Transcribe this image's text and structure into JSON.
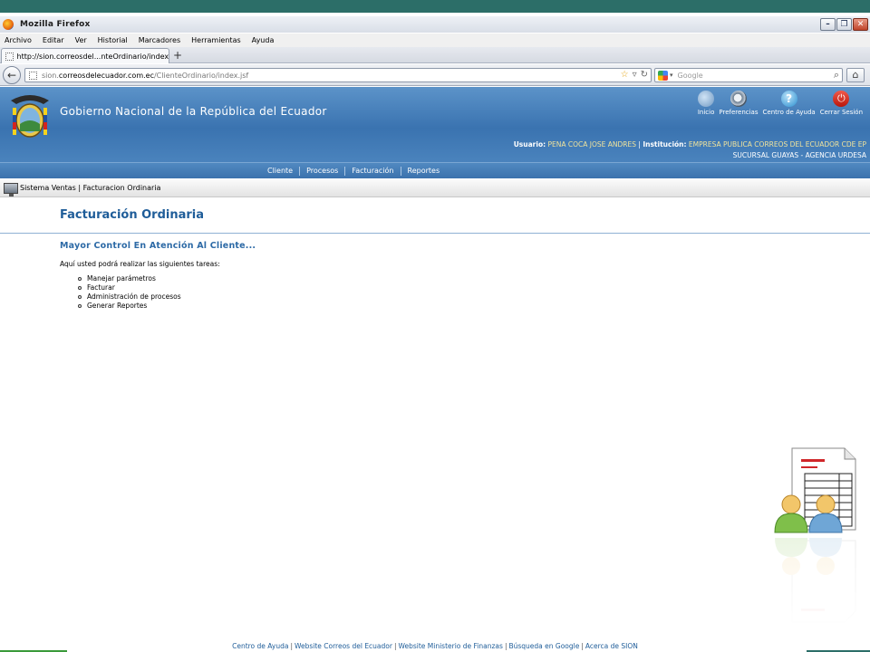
{
  "browser": {
    "window_title": "Mozilla Firefox",
    "menu": [
      "Archivo",
      "Editar",
      "Ver",
      "Historial",
      "Marcadores",
      "Herramientas",
      "Ayuda"
    ],
    "tab_title": "http://sion.correosdel...nteOrdinario/index.jsf",
    "url_prefix": "sion.",
    "url_domain": "correosdelecuador.com.ec",
    "url_path": "/ClienteOrdinario/index.jsf",
    "search_placeholder": "Google"
  },
  "header": {
    "gov_title": "Gobierno Nacional de la República del Ecuador",
    "icons": [
      {
        "label": "Inicio",
        "icon": "home-icon"
      },
      {
        "label": "Preferencias",
        "icon": "gears-icon"
      },
      {
        "label": "Centro de Ayuda",
        "icon": "help-icon"
      },
      {
        "label": "Cerrar Sesión",
        "icon": "power-icon"
      }
    ],
    "user_label": "Usuario:",
    "user_value": "PENA COCA JOSE ANDRES",
    "sep": "|",
    "inst_label": "Institución:",
    "inst_value": "EMPRESA PUBLICA CORREOS DEL ECUADOR CDE EP",
    "branch_value": "SUCURSAL GUAYAS - AGENCIA URDESA"
  },
  "nav": [
    "Cliente",
    "Procesos",
    "Facturación",
    "Reportes"
  ],
  "breadcrumb": "Sistema Ventas | Facturacion Ordinaria",
  "main": {
    "title": "Facturación Ordinaria",
    "subtitle": "Mayor Control En Atención Al Cliente...",
    "intro": "Aquí usted podrá realizar las siguientes tareas:",
    "tasks": [
      "Manejar parámetros",
      "Facturar",
      "Administración de procesos",
      "Generar Reportes"
    ]
  },
  "footer": [
    "Centro de Ayuda",
    "Website Correos del Ecuador",
    "Website Ministerio de Finanzas",
    "Búsqueda en Google",
    "Acerca de SION"
  ]
}
